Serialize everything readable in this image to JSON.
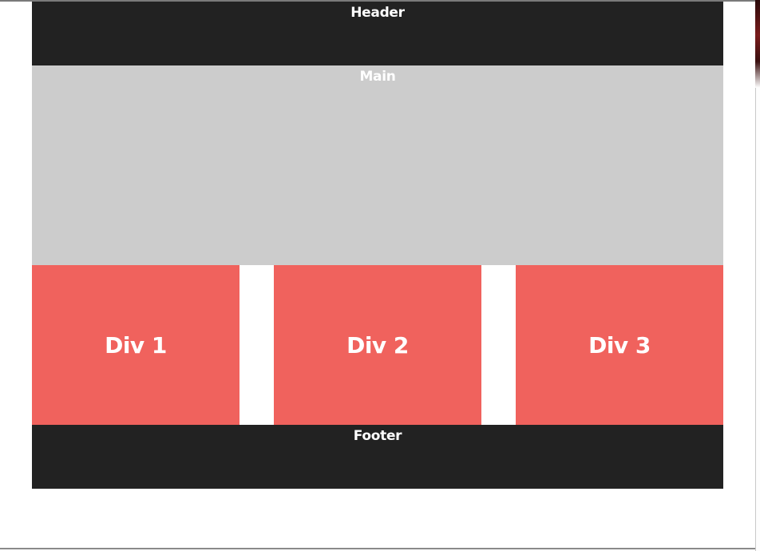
{
  "header": {
    "label": "Header"
  },
  "main": {
    "label": "Main"
  },
  "divs": [
    {
      "label": "Div 1"
    },
    {
      "label": "Div 2"
    },
    {
      "label": "Div 3"
    }
  ],
  "footer": {
    "label": "Footer"
  },
  "colors": {
    "header_bg": "#222222",
    "main_bg": "#cccccc",
    "div_bg": "#f0625d",
    "footer_bg": "#222222",
    "text": "#ffffff"
  }
}
